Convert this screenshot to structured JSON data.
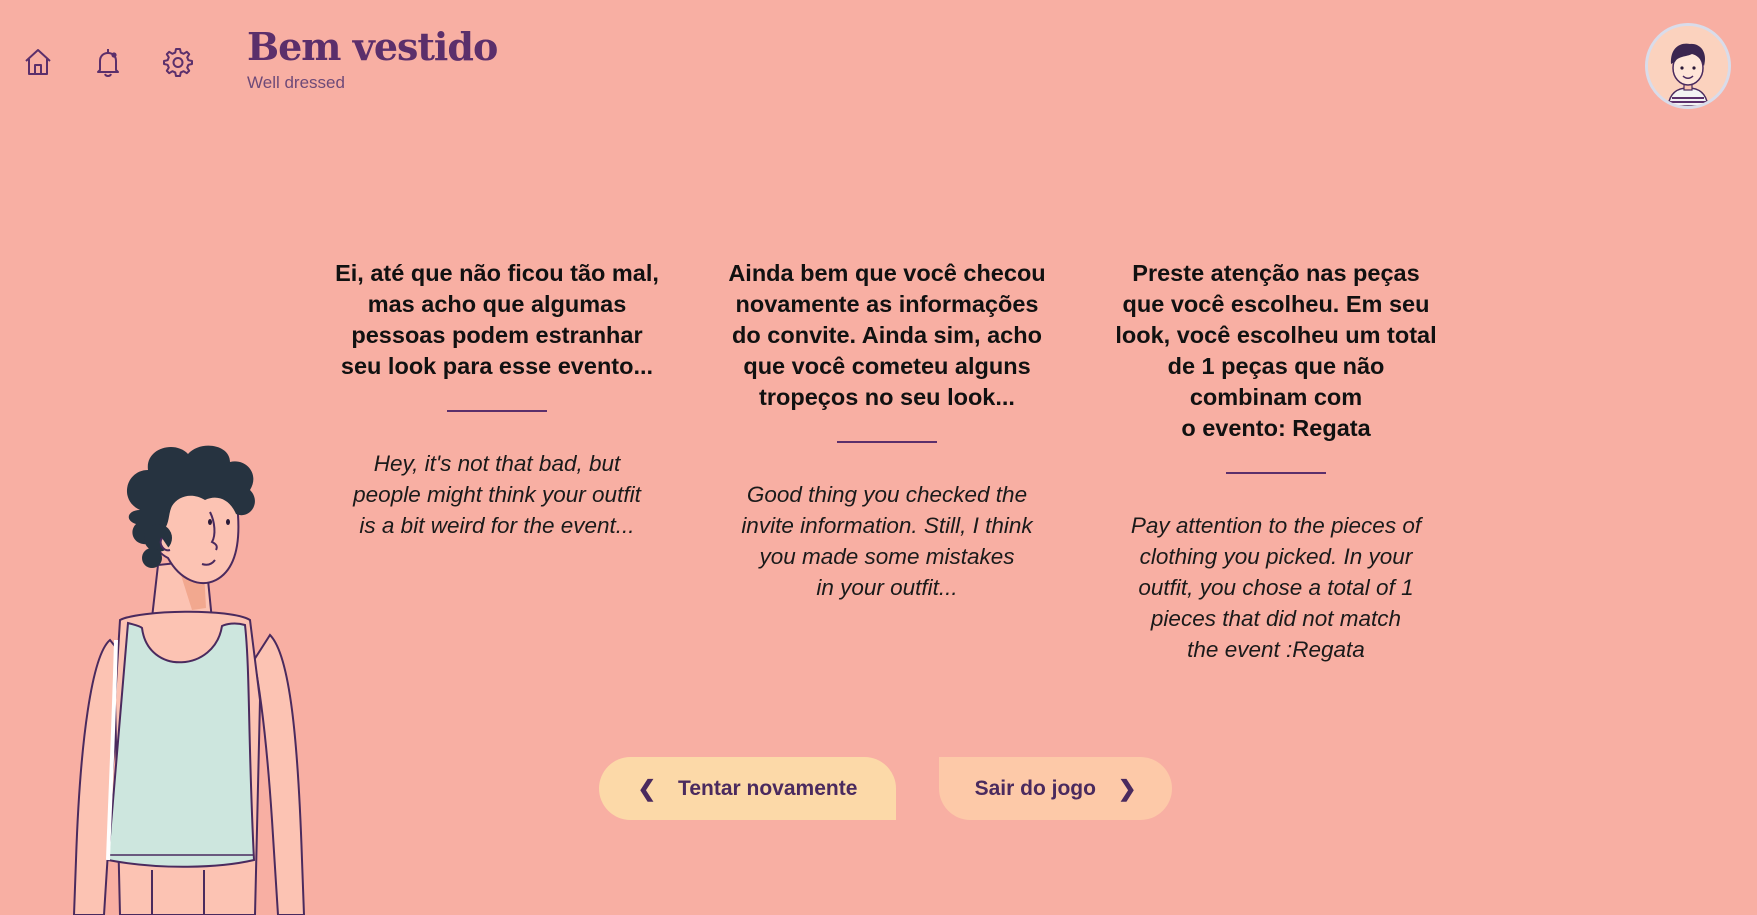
{
  "header": {
    "title": "Bem vestido",
    "subtitle": "Well dressed",
    "nav": {
      "home_icon": "home-icon",
      "notifications_icon": "bell-icon",
      "settings_icon": "gear-icon"
    },
    "avatar_icon": "user-avatar"
  },
  "feedback": [
    {
      "pt_lines": [
        "Ei, até que não ficou tão mal,",
        "mas acho que algumas",
        "pessoas podem estranhar",
        "seu look para esse evento..."
      ],
      "en_lines": [
        "Hey, it's not that bad, but",
        "people might think your outfit",
        "is a bit weird for the event..."
      ]
    },
    {
      "pt_lines": [
        "Ainda bem que você checou",
        "novamente as informações",
        "do convite. Ainda sim, acho",
        "que você cometeu alguns",
        "tropeços no seu look..."
      ],
      "en_lines": [
        "Good thing you checked the",
        "invite information. Still, I think",
        "you made some mistakes",
        "in your outfit..."
      ]
    },
    {
      "pt_lines": [
        "Preste atenção nas peças",
        "que você escolheu. Em seu",
        "look, você escolheu um total",
        "de 1 peças que não",
        "combinam com",
        "o evento: Regata"
      ],
      "en_lines": [
        "Pay attention to the pieces of",
        "clothing you picked. In your",
        "outfit, you chose a total of 1",
        "pieces that did not match",
        "the event :Regata"
      ]
    }
  ],
  "actions": {
    "retry_label": "Tentar novamente",
    "exit_label": "Sair do jogo",
    "retry_icon": "chevron-left-icon",
    "exit_icon": "chevron-right-icon"
  },
  "colors": {
    "background": "#F8AFA3",
    "accent": "#5B2F6B",
    "retry_button": "#FCD9A8",
    "exit_button": "#FDC9A8"
  }
}
